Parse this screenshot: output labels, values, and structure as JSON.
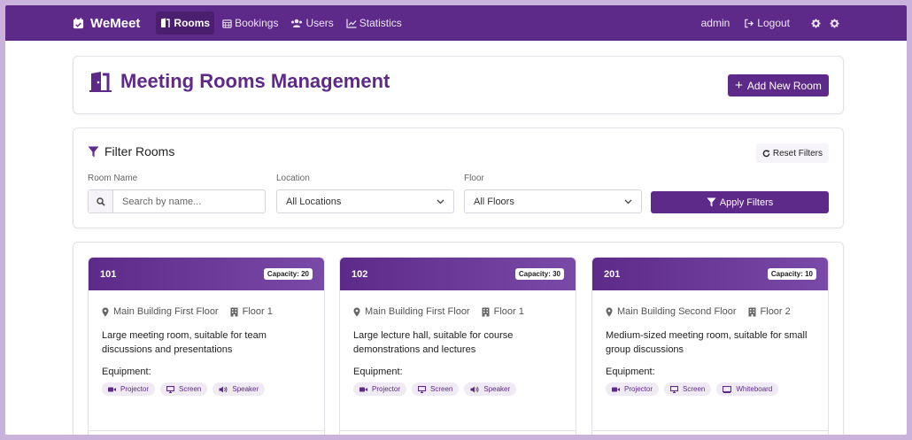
{
  "colors": {
    "primary": "#5d2a8a",
    "frame": "#c9b3dd"
  },
  "navbar": {
    "brand": "WeMeet",
    "items": [
      {
        "label": "Rooms",
        "icon": "door-icon",
        "active": true
      },
      {
        "label": "Bookings",
        "icon": "calendar-icon",
        "active": false
      },
      {
        "label": "Users",
        "icon": "users-icon",
        "active": false
      },
      {
        "label": "Statistics",
        "icon": "chart-line-icon",
        "active": false
      }
    ],
    "user": "admin",
    "logout": "Logout"
  },
  "header": {
    "title": "Meeting Rooms Management",
    "add_button": "Add New Room"
  },
  "filters": {
    "title": "Filter Rooms",
    "reset": "Reset Filters",
    "room_name_label": "Room Name",
    "room_name_placeholder": "Search by name...",
    "location_label": "Location",
    "location_value": "All Locations",
    "floor_label": "Floor",
    "floor_value": "All Floors",
    "apply": "Apply Filters"
  },
  "equipment_label": "Equipment:",
  "rooms": [
    {
      "number": "101",
      "capacity": "Capacity: 20",
      "location": "Main Building First Floor",
      "floor": "Floor 1",
      "description": "Large meeting room, suitable for team discussions and presentations",
      "equipment": [
        "Projector",
        "Screen",
        "Speaker"
      ]
    },
    {
      "number": "102",
      "capacity": "Capacity: 30",
      "location": "Main Building First Floor",
      "floor": "Floor 1",
      "description": "Large lecture hall, suitable for course demonstrations and lectures",
      "equipment": [
        "Projector",
        "Screen",
        "Speaker"
      ]
    },
    {
      "number": "201",
      "capacity": "Capacity: 10",
      "location": "Main Building Second Floor",
      "floor": "Floor 2",
      "description": "Medium-sized meeting room, suitable for small group discussions",
      "equipment": [
        "Projector",
        "Screen",
        "Whiteboard"
      ]
    }
  ]
}
